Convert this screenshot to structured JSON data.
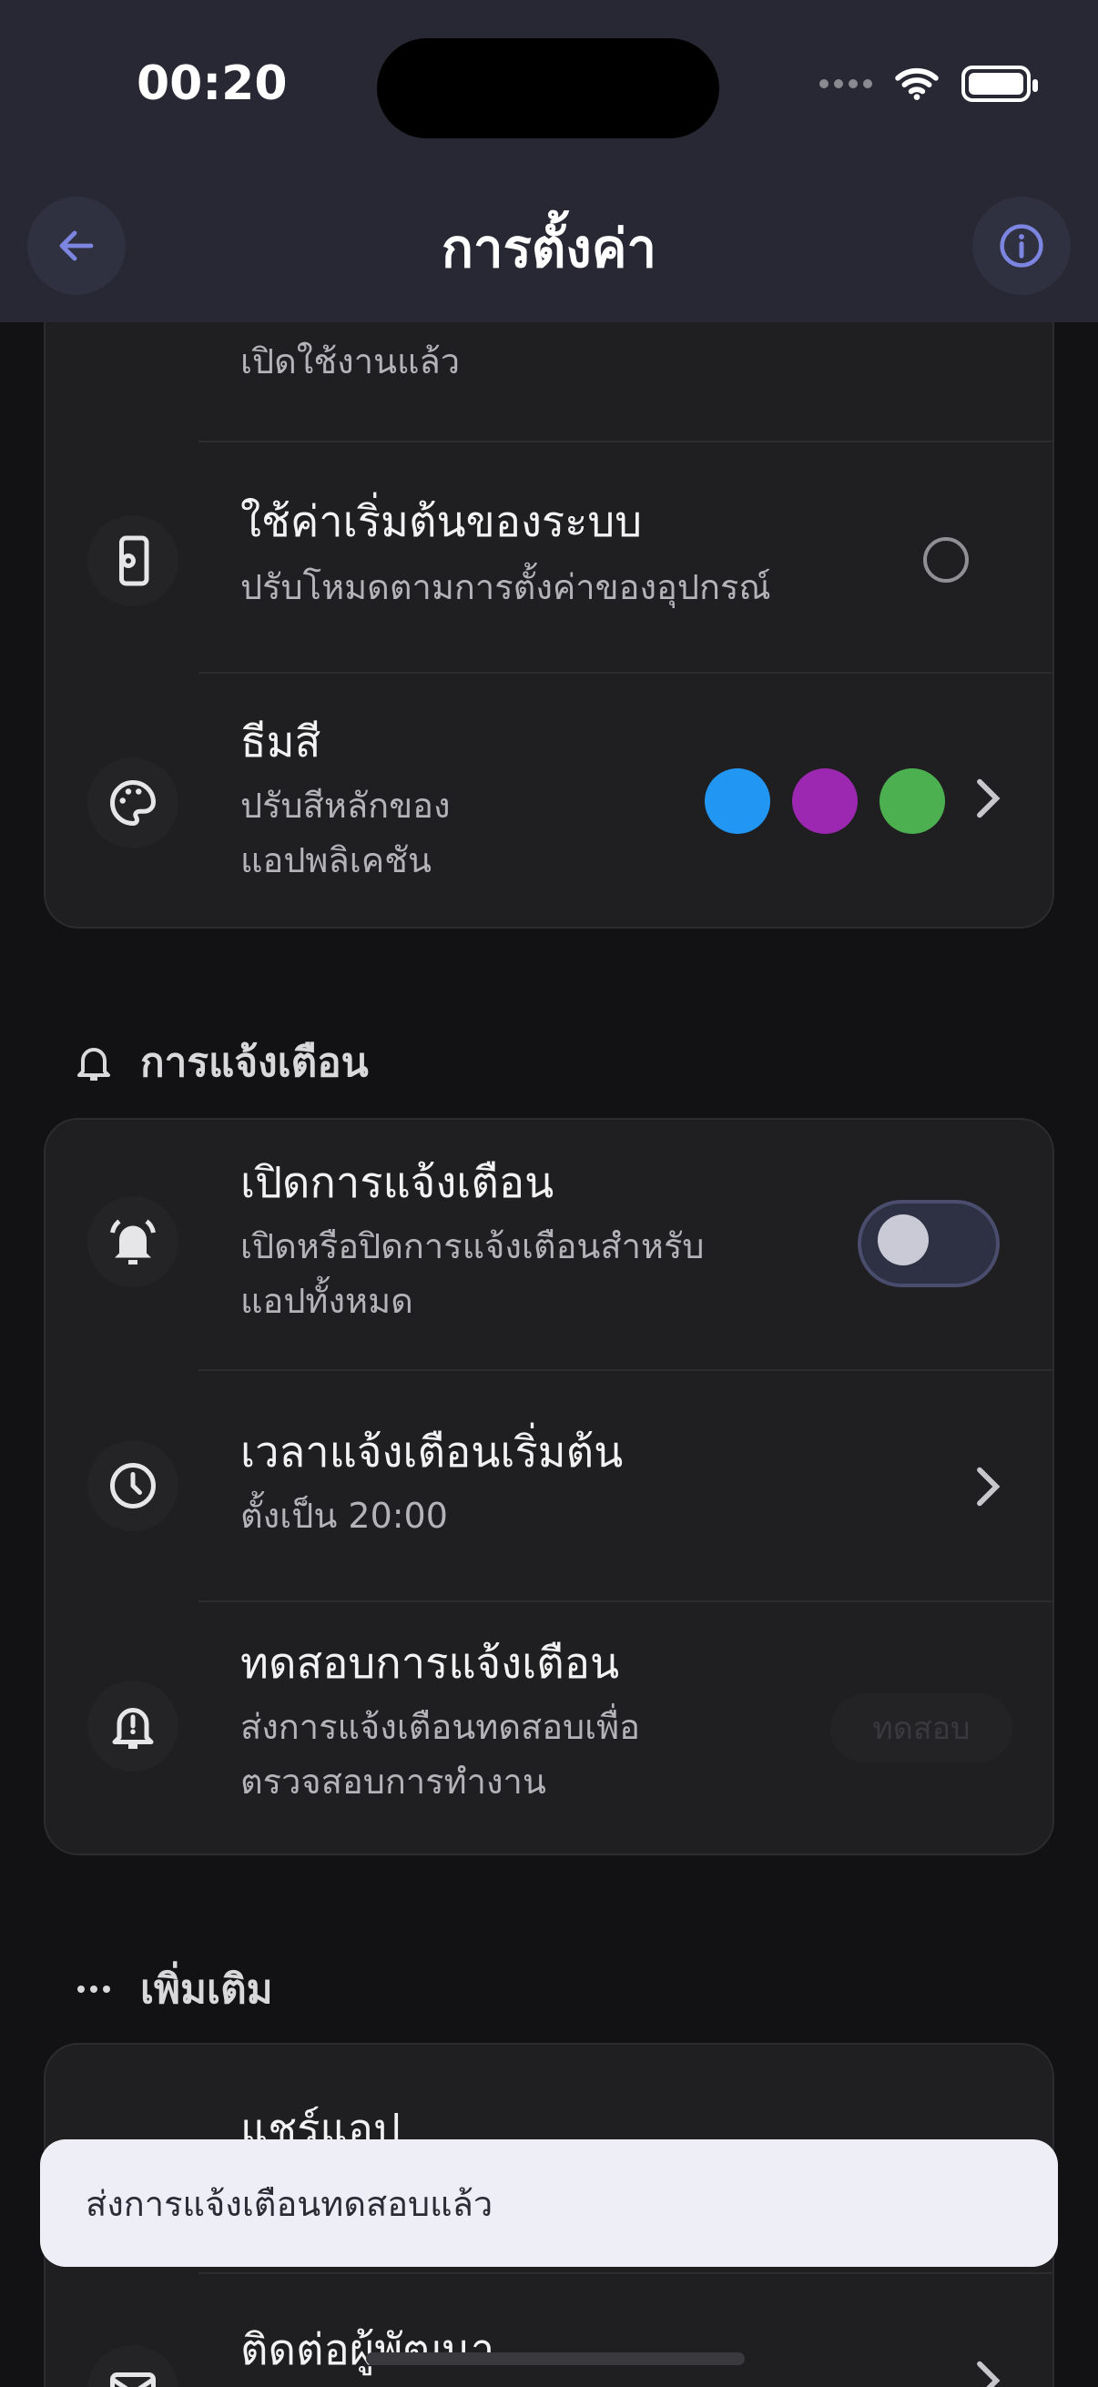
{
  "status_bar": {
    "time": "00:20"
  },
  "header": {
    "title": "การตั้งค่า"
  },
  "appearance": {
    "dark_mode_subtitle": "เปิดใช้งานแล้ว",
    "system_default": {
      "title": "ใช้ค่าเริ่มต้นของระบบ",
      "subtitle": "ปรับโหมดตามการตั้งค่าของอุปกรณ์"
    },
    "theme_color": {
      "title": "ธีมสี",
      "subtitle_line1": "ปรับสีหลักของ",
      "subtitle_line2": "แอปพลิเคชัน",
      "swatches": [
        "#2196F3",
        "#9C27B0",
        "#4CAF50"
      ]
    }
  },
  "notifications_section": {
    "label": "การแจ้งเตือน",
    "enable": {
      "title": "เปิดการแจ้งเตือน",
      "subtitle_line1": "เปิดหรือปิดการแจ้งเตือนสำหรับ",
      "subtitle_line2": "แอปทั้งหมด",
      "enabled": false
    },
    "default_time": {
      "title": "เวลาแจ้งเตือนเริ่มต้น",
      "subtitle": "ตั้งเป็น 20:00"
    },
    "test": {
      "title": "ทดสอบการแจ้งเตือน",
      "subtitle_line1": "ส่งการแจ้งเตือนทดสอบเพื่อ",
      "subtitle_line2": "ตรวจสอบการทำงาน",
      "button_label": "ทดสอบ"
    }
  },
  "more_section": {
    "label": "เพิ่มเติม",
    "share": {
      "title": "แชร์แอป"
    },
    "contact": {
      "title": "ติดต่อผู้พัฒนา"
    }
  },
  "toast": {
    "message": "ส่งการแจ้งเตือนทดสอบแล้ว"
  },
  "colors": {
    "accent": "#7c85e0",
    "toggle_on": "#4a4f8f",
    "card": "#1f1f21",
    "topbar": "#272833"
  }
}
